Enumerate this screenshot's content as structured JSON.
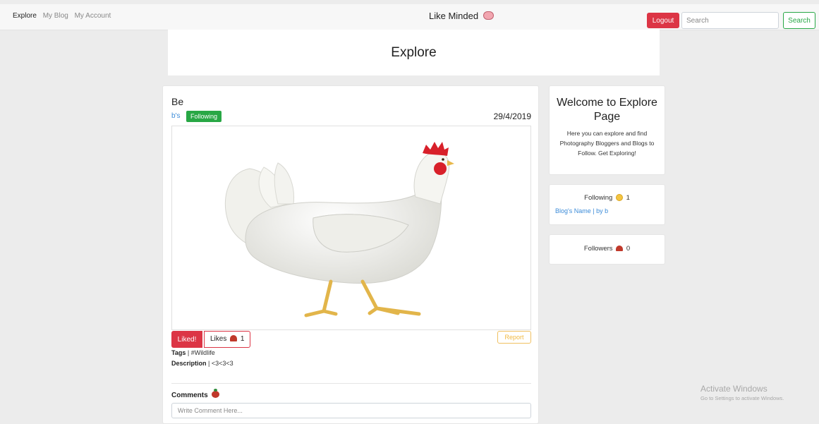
{
  "nav": {
    "links": [
      "Explore",
      "My Blog",
      "My Account"
    ],
    "brand": "Like Minded",
    "logout_label": "Logout",
    "search_placeholder": "Search",
    "search_button": "Search"
  },
  "header": {
    "title": "Explore"
  },
  "post": {
    "title": "Be",
    "author": "b's",
    "following_badge": "Following",
    "date": "29/4/2019",
    "liked_label": "Liked!",
    "likes_label": "Likes",
    "likes_count": "1",
    "report_label": "Report",
    "tags_label": "Tags",
    "tags_value": "#Wildlife",
    "description_label": "Description",
    "description_value": "<3<3<3",
    "comments_label": "Comments",
    "comment_placeholder": "Write Comment Here..."
  },
  "sidebar": {
    "welcome_title": "Welcome to Explore Page",
    "welcome_text": "Here you can explore and find Photography Bloggers and Blogs to Follow. Get Exploring!",
    "following_label": "Following",
    "following_count": "1",
    "following_blog": "Blog's Name | by b",
    "followers_label": "Followers",
    "followers_count": "0"
  },
  "watermark": {
    "title": "Activate Windows",
    "subtitle": "Go to Settings to activate Windows."
  },
  "colors": {
    "danger": "#dc3545",
    "success": "#28a745",
    "link": "#3b8bd8",
    "warning": "#f0b840"
  }
}
